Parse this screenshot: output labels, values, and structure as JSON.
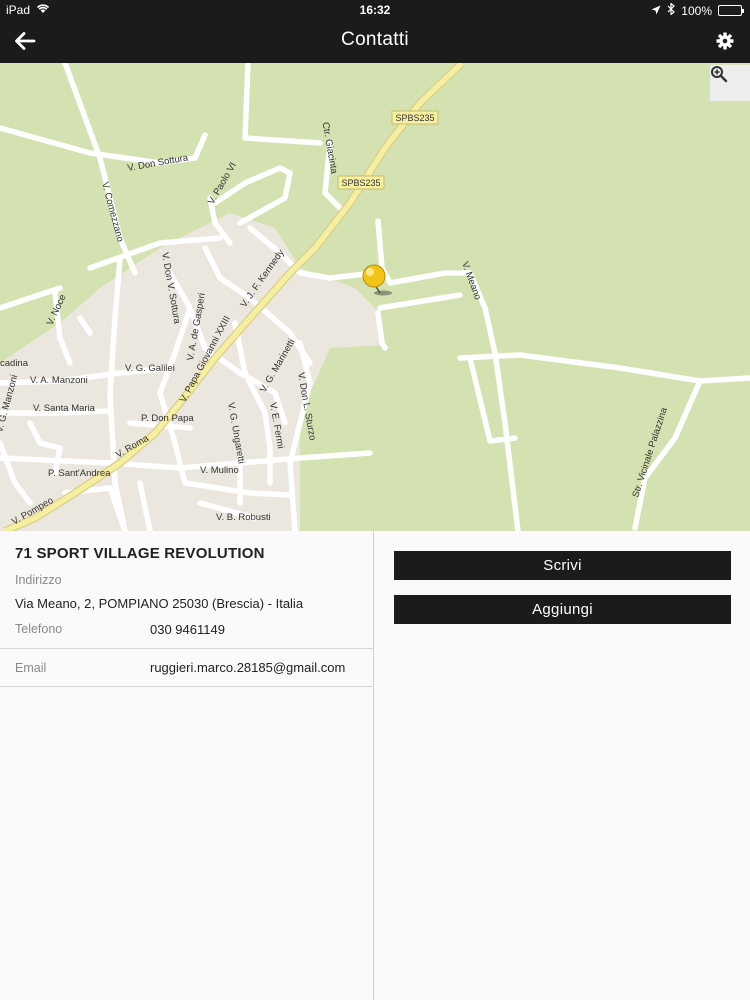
{
  "status_bar": {
    "device": "iPad",
    "time": "16:32",
    "battery": "100%"
  },
  "nav": {
    "title": "Contatti",
    "back_icon": "arrow-left-icon",
    "settings_icon": "gear-icon"
  },
  "map": {
    "zoom_icon": "zoom-in-icon",
    "marker_icon": "map-pin-icon",
    "road_labels": {
      "sp1": "SPBS235",
      "sp2": "SPBS235",
      "ctr_giacinta": "Ctr. Giacinta",
      "don_sottura": "V. Don Sottura",
      "comezzano": "V. Comezzano",
      "paolo_vi": "V. Paolo VI",
      "kennedy": "V. J. F. Kennedy",
      "meano": "V. Meano",
      "noce": "V. Noce",
      "don_v_sottura": "V. Don V. Sottura",
      "de_gasperi": "V. A. de Gasperi",
      "papa_giovanni": "V. Papa Giovanni XXIII",
      "manzoni_a": "V. A. Manzoni",
      "galilei": "V. G. Galilei",
      "marinetti": "V. G. Marinetti",
      "don_l_sturzo": "V. Don L. Sturzo",
      "santa_maria": "V. Santa Maria",
      "p_don_papa": "P. Don Papa",
      "roma": "V. Roma",
      "ungaretti": "V. G. Ungaretti",
      "fermi": "V. E. Fermi",
      "sant_andrea": "P. Sant'Andrea",
      "mulino": "V. Mulino",
      "pompeo": "V. Pompeo",
      "robusti": "V. B. Robusti",
      "cadina": "cadina",
      "g_manzoni": "V. G. Manzoni",
      "palazzina": "Str. Vicinale Palazzina"
    }
  },
  "contact": {
    "name": "71 SPORT VILLAGE REVOLUTION",
    "address_label": "Indirizzo",
    "address_value": "Via Meano, 2, POMPIANO 25030 (Brescia) - Italia",
    "phone_label": "Telefono",
    "phone_value": "030 9461149",
    "email_label": "Email",
    "email_value": "ruggieri.marco.28185@gmail.com"
  },
  "actions": {
    "write_label": "Scrivi",
    "add_label": "Aggiungi"
  },
  "colors": {
    "bar": "#1b1b1b",
    "map_green": "#d4e2b1",
    "urban": "#ece7de",
    "highway": "#f6eea0",
    "pin": "#f2c418"
  }
}
